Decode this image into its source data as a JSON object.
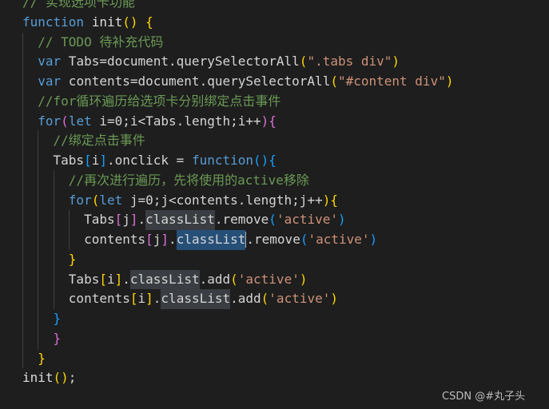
{
  "editor": {
    "theme_colors": {
      "background": "#1e1e1e",
      "keyword": "#569cd6",
      "comment": "#6a9955",
      "string": "#ce9178",
      "bracket_gold": "#ffd700",
      "bracket_purple": "#da70d6",
      "bracket_blue": "#179fff",
      "selection": "#264f78",
      "highlight": "#3a3d41"
    },
    "lines": [
      {
        "indent": 0,
        "tokens": [
          [
            "// 实现选项卡功能",
            "cm"
          ]
        ]
      },
      {
        "indent": 0,
        "tokens": [
          [
            "function",
            "kw"
          ],
          [
            " init",
            "fn"
          ],
          [
            "()",
            "gold"
          ],
          [
            " ",
            ""
          ],
          [
            "{",
            "gold"
          ]
        ]
      },
      {
        "indent": 1,
        "tokens": [
          [
            "// TODO 待补充代码",
            "cm"
          ]
        ]
      },
      {
        "indent": 1,
        "tokens": [
          [
            "var",
            "kw"
          ],
          [
            " Tabs=document.querySelectorAll",
            ""
          ],
          [
            "(",
            "gold"
          ],
          [
            "\".tabs div\"",
            "str"
          ],
          [
            ")",
            "gold"
          ]
        ]
      },
      {
        "indent": 1,
        "tokens": [
          [
            "var",
            "kw"
          ],
          [
            " contents=document.querySelectorAll",
            ""
          ],
          [
            "(",
            "gold"
          ],
          [
            "\"#content div\"",
            "str"
          ],
          [
            ")",
            "gold"
          ]
        ]
      },
      {
        "indent": 1,
        "tokens": [
          [
            "//for循环遍历给选项卡分别绑定点击事件",
            "cm"
          ]
        ]
      },
      {
        "indent": 1,
        "tokens": [
          [
            "for",
            "kw"
          ],
          [
            "(",
            "pur"
          ],
          [
            "let",
            "kw"
          ],
          [
            " i=0;i<Tabs.length;i++",
            ""
          ],
          [
            "){",
            "pur"
          ]
        ]
      },
      {
        "indent": 2,
        "tokens": [
          [
            "//绑定点击事件",
            "cm"
          ]
        ]
      },
      {
        "indent": 2,
        "tokens": [
          [
            "Tabs",
            ""
          ],
          [
            "[",
            "blu"
          ],
          [
            "i",
            ""
          ],
          [
            "]",
            "blu"
          ],
          [
            ".onclick = ",
            ""
          ],
          [
            "function",
            "kw"
          ],
          [
            "(){",
            "blu"
          ]
        ]
      },
      {
        "indent": 3,
        "tokens": [
          [
            "//再次进行遍历，先将使用的active移除",
            "cm"
          ]
        ]
      },
      {
        "indent": 3,
        "tokens": [
          [
            "for",
            "kw"
          ],
          [
            "(",
            "gold"
          ],
          [
            "let",
            "kw"
          ],
          [
            " j=0;j<contents.length;j++",
            ""
          ],
          [
            "){",
            "gold"
          ]
        ]
      },
      {
        "indent": 4,
        "tokens": [
          [
            "Tabs",
            ""
          ],
          [
            "[",
            "pur"
          ],
          [
            "j",
            ""
          ],
          [
            "]",
            "pur"
          ],
          [
            ".",
            ""
          ],
          [
            "classList",
            "hl"
          ],
          [
            ".remove",
            ""
          ],
          [
            "(",
            "blu"
          ],
          [
            "'active'",
            "str"
          ],
          [
            ")",
            "blu"
          ]
        ]
      },
      {
        "indent": 4,
        "tokens": [
          [
            "contents",
            ""
          ],
          [
            "[",
            "pur"
          ],
          [
            "j",
            ""
          ],
          [
            "]",
            "pur"
          ],
          [
            ".",
            ""
          ],
          [
            "classList",
            "sel"
          ],
          [
            "",
            "cursor"
          ],
          [
            ".remove",
            ""
          ],
          [
            "(",
            "blu"
          ],
          [
            "'active'",
            "str"
          ],
          [
            ")",
            "blu"
          ]
        ]
      },
      {
        "indent": 3,
        "tokens": [
          [
            "}",
            "gold"
          ]
        ]
      },
      {
        "indent": 3,
        "tokens": [
          [
            "Tabs",
            ""
          ],
          [
            "[",
            "gold"
          ],
          [
            "i",
            ""
          ],
          [
            "]",
            "gold"
          ],
          [
            ".",
            ""
          ],
          [
            "classList",
            "hl"
          ],
          [
            ".add",
            ""
          ],
          [
            "(",
            "gold"
          ],
          [
            "'active'",
            "str"
          ],
          [
            ")",
            "gold"
          ]
        ]
      },
      {
        "indent": 3,
        "tokens": [
          [
            "contents",
            ""
          ],
          [
            "[",
            "gold"
          ],
          [
            "i",
            ""
          ],
          [
            "]",
            "gold"
          ],
          [
            ".",
            ""
          ],
          [
            "classList",
            "hl"
          ],
          [
            ".add",
            ""
          ],
          [
            "(",
            "gold"
          ],
          [
            "'active'",
            "str"
          ],
          [
            ")",
            "gold"
          ]
        ]
      },
      {
        "indent": 2,
        "tokens": [
          [
            "}",
            "blu"
          ]
        ]
      },
      {
        "indent": 2,
        "tokens": [
          [
            "}",
            "pur"
          ]
        ]
      },
      {
        "indent": 1,
        "tokens": [
          [
            "}",
            "gold"
          ]
        ]
      },
      {
        "indent": 0,
        "tokens": [
          [
            "init",
            "fn"
          ],
          [
            "()",
            "gold"
          ],
          [
            ";",
            ""
          ]
        ]
      }
    ]
  },
  "watermark": "CSDN @#丸子头"
}
